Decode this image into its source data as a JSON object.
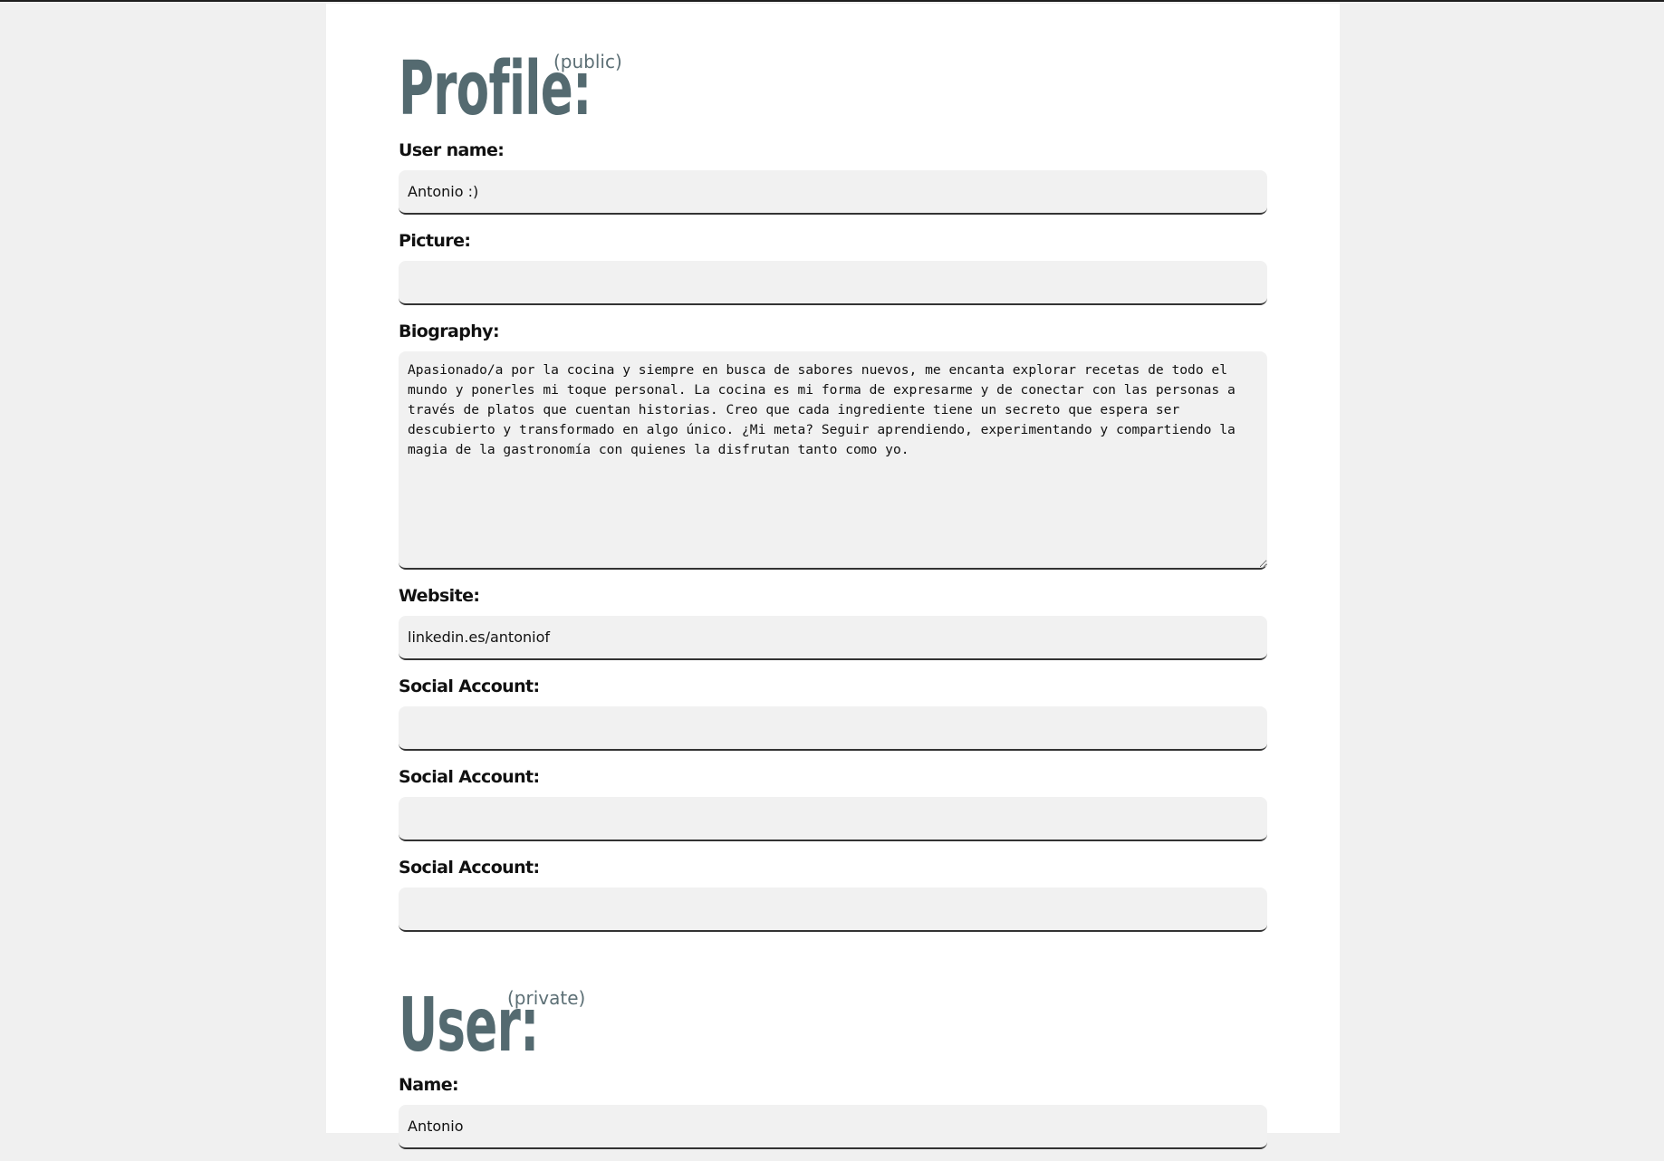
{
  "profile": {
    "heading": "Profile:",
    "visibility": "(public)",
    "fields": {
      "user_name": {
        "label": "User name:",
        "value": "Antonio :)"
      },
      "picture": {
        "label": "Picture:",
        "value": ""
      },
      "biography": {
        "label": "Biography:",
        "value": "Apasionado/a por la cocina y siempre en busca de sabores nuevos, me encanta explorar recetas de todo el mundo y ponerles mi toque personal. La cocina es mi forma de expresarme y de conectar con las personas a través de platos que cuentan historias. Creo que cada ingrediente tiene un secreto que espera ser descubierto y transformado en algo único. ¿Mi meta? Seguir aprendiendo, experimentando y compartiendo la magia de la gastronomía con quienes la disfrutan tanto como yo."
      },
      "website": {
        "label": "Website:",
        "value": "linkedin.es/antoniof"
      },
      "social_1": {
        "label": "Social Account:",
        "value": ""
      },
      "social_2": {
        "label": "Social Account:",
        "value": ""
      },
      "social_3": {
        "label": "Social Account:",
        "value": ""
      }
    }
  },
  "user": {
    "heading": "User:",
    "visibility": "(private)",
    "fields": {
      "name": {
        "label": "Name:",
        "value": "Antonio"
      }
    }
  },
  "colors": {
    "page_background": "#f0f0f0",
    "panel_background": "#ffffff",
    "heading": "#546a70",
    "input_background": "#f1f1f1"
  }
}
